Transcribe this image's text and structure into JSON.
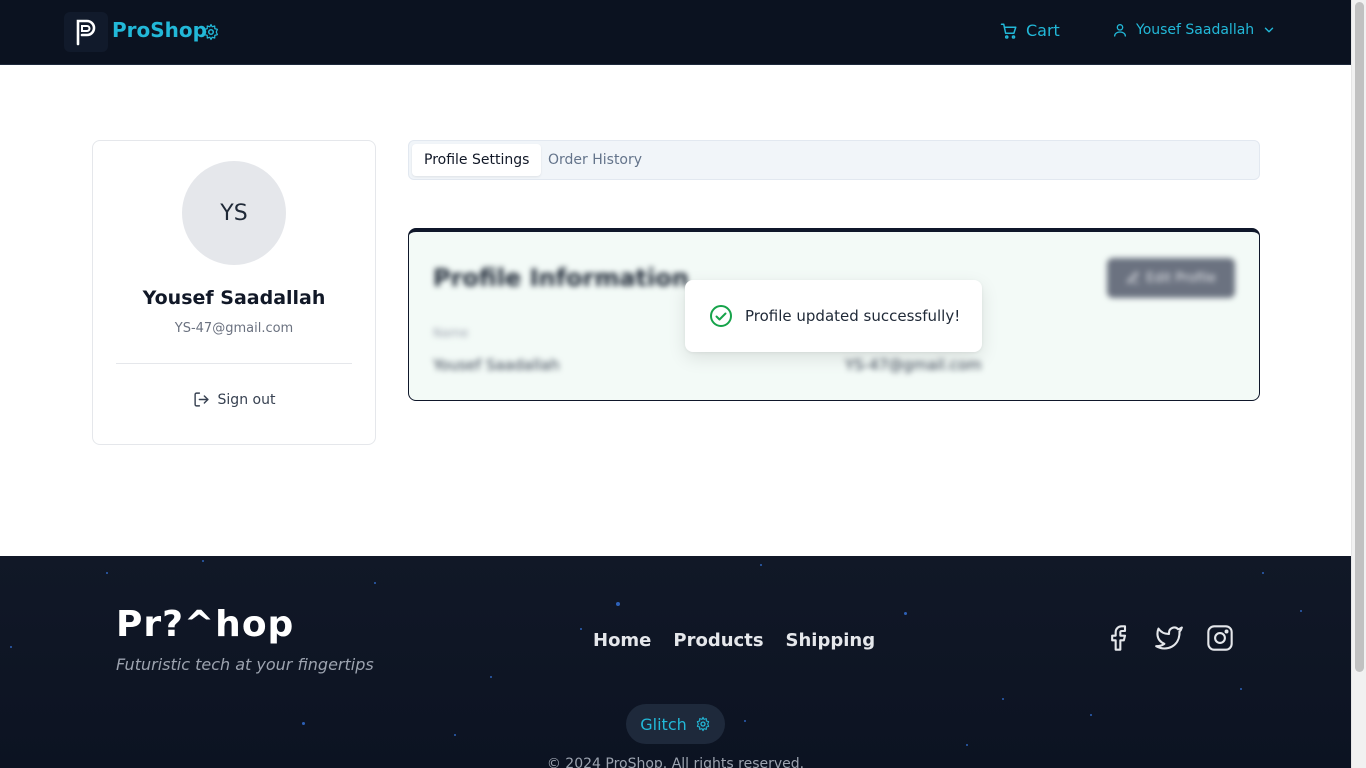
{
  "header": {
    "brand": "ProShop",
    "cart_label": "Cart",
    "user_name": "Yousef Saadallah"
  },
  "profile_card": {
    "initials": "YS",
    "name": "Yousef Saadallah",
    "email": "YS-47@gmail.com",
    "signout_label": "Sign out"
  },
  "tabs": [
    {
      "label": "Profile Settings",
      "active": true
    },
    {
      "label": "Order History",
      "active": false
    }
  ],
  "profile_info": {
    "title": "Profile Information",
    "edit_label": "Edit Profile",
    "name_label": "Name",
    "name_value": "Yousef Saadallah",
    "email_value": "YS-47@gmail.com"
  },
  "toast": {
    "message": "Profile updated successfully!"
  },
  "footer": {
    "brand": "Pr?^hop",
    "tagline": "Futuristic tech at your fingertips",
    "nav": [
      "Home",
      "Products",
      "Shipping"
    ],
    "social_icons": [
      "facebook-icon",
      "twitter-icon",
      "instagram-icon"
    ],
    "glitch_label": "Glitch",
    "copyright": "© 2024 ProShop. All rights reserved."
  },
  "colors": {
    "accent": "#22b8d8",
    "header_bg": "#0b1220",
    "footer_bg": "#111827",
    "success": "#16a34a"
  }
}
